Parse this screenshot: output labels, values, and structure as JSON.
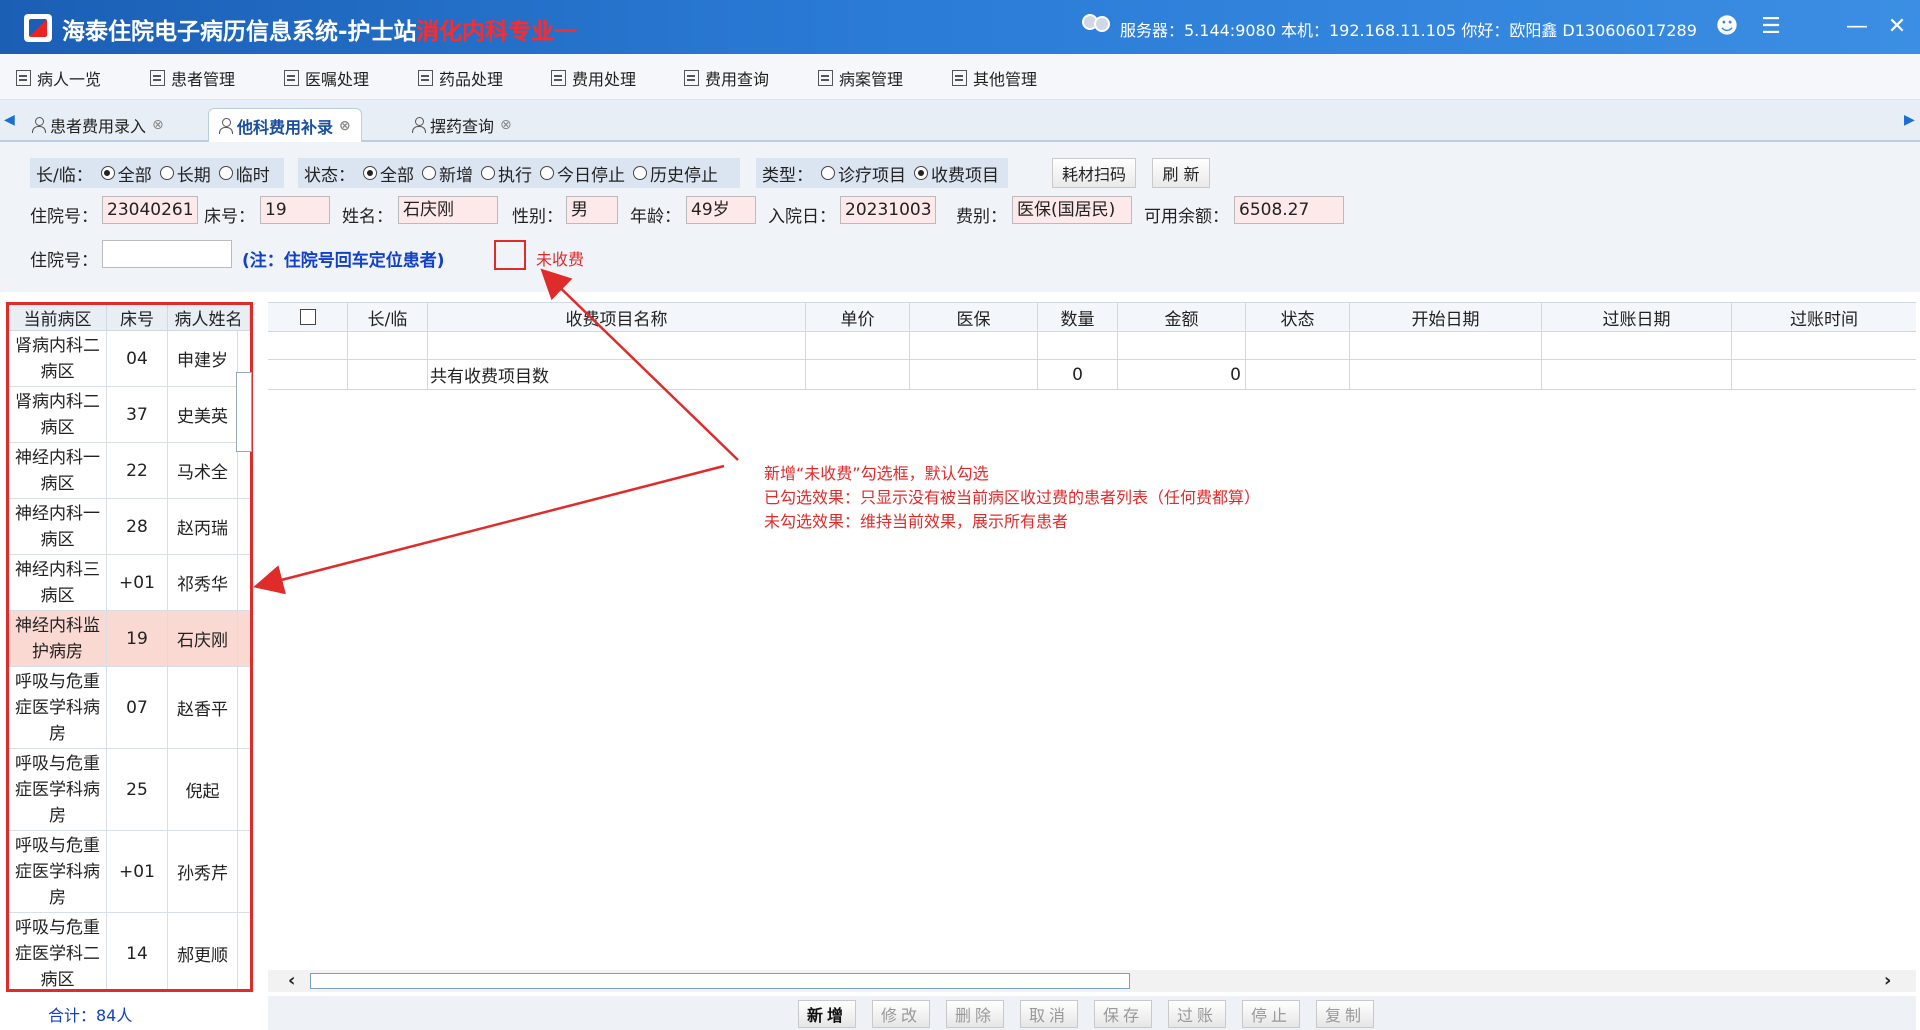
{
  "titlebar": {
    "app_title": "海泰住院电子病历信息系统-护士站",
    "app_sub": "消化内科专业一",
    "server_info": "服务器：5.144:9080 本机：192.168.11.105 你好：欧阳鑫 D130606017289",
    "icons": [
      "user-icon",
      "layers-icon",
      "minimize-icon",
      "close-icon"
    ]
  },
  "menu": [
    "病人一览",
    "患者管理",
    "医嘱处理",
    "药品处理",
    "费用处理",
    "费用查询",
    "病案管理",
    "其他管理"
  ],
  "tabs": [
    {
      "label": "患者费用录入",
      "active": false
    },
    {
      "label": "他科费用补录",
      "active": true
    },
    {
      "label": "摆药查询",
      "active": false
    }
  ],
  "filters": {
    "longtemp_label": "长/临：",
    "longtemp_options": [
      "全部",
      "长期",
      "临时"
    ],
    "longtemp_selected": "全部",
    "status_label": "状态：",
    "status_options": [
      "全部",
      "新增",
      "执行",
      "今日停止",
      "历史停止"
    ],
    "status_selected": "全部",
    "type_label": "类型：",
    "type_options": [
      "诊疗项目",
      "收费项目"
    ],
    "type_selected": "收费项目",
    "scan_button": "耗材扫码",
    "refresh_button": "刷 新"
  },
  "patient": {
    "admission_no_label": "住院号：",
    "admission_no": "23040261",
    "bed_label": "床号：",
    "bed": "19",
    "name_label": "姓名：",
    "name": "石庆刚",
    "sex_label": "性别：",
    "sex": "男",
    "age_label": "年龄：",
    "age": "49岁",
    "admit_date_label": "入院日：",
    "admit_date": "20231003",
    "fee_type_label": "费别：",
    "fee_type": "医保(国居民)",
    "balance_label": "可用余额：",
    "balance": "6508.27"
  },
  "search": {
    "admission_label": "住院号：",
    "admission_value": "",
    "note": "(注：住院号回车定位患者)",
    "unpaid_label": "未收费"
  },
  "patient_list": {
    "headers": [
      "当前病区",
      "床号",
      "病人姓名"
    ],
    "rows": [
      {
        "ward": "肾病内科二病区",
        "bed": "04",
        "name": "申建岁"
      },
      {
        "ward": "肾病内科二病区",
        "bed": "37",
        "name": "史美英"
      },
      {
        "ward": "神经内科一病区",
        "bed": "22",
        "name": "马术全"
      },
      {
        "ward": "神经内科一病区",
        "bed": "28",
        "name": "赵丙瑞"
      },
      {
        "ward": "神经内科三病区",
        "bed": "+01",
        "name": "祁秀华"
      },
      {
        "ward": "神经内科监护病房",
        "bed": "19",
        "name": "石庆刚",
        "selected": true
      },
      {
        "ward": "呼吸与危重症医学科病房",
        "bed": "07",
        "name": "赵香平"
      },
      {
        "ward": "呼吸与危重症医学科病房",
        "bed": "25",
        "name": "倪起"
      },
      {
        "ward": "呼吸与危重症医学科病房",
        "bed": "+01",
        "name": "孙秀芹"
      },
      {
        "ward": "呼吸与危重症医学科二病区",
        "bed": "14",
        "name": "郝更顺"
      }
    ],
    "total": "合计：84人"
  },
  "fee_table": {
    "headers": [
      "",
      "长/临",
      "收费项目名称",
      "单价",
      "医保",
      "数量",
      "金额",
      "状态",
      "开始日期",
      "过账日期",
      "过账时间"
    ],
    "summary_label": "共有收费项目数",
    "summary_qty": "0",
    "summary_amount": "0"
  },
  "bottom_buttons": [
    {
      "label": "新增",
      "enabled": true
    },
    {
      "label": "修改",
      "enabled": false
    },
    {
      "label": "删除",
      "enabled": false
    },
    {
      "label": "取消",
      "enabled": false
    },
    {
      "label": "保存",
      "enabled": false
    },
    {
      "label": "过账",
      "enabled": false
    },
    {
      "label": "停止",
      "enabled": false
    },
    {
      "label": "复制",
      "enabled": false
    }
  ],
  "annotation": {
    "line1": "新增“未收费”勾选框，默认勾选",
    "line2": "已勾选效果：只显示没有被当前病区收过费的患者列表（任何费都算）",
    "line3": "未勾选效果：维持当前效果，展示所有患者"
  },
  "colors": {
    "accent": "#1b5fb5",
    "annotation": "#e02b2b",
    "selected_row": "#f9d9d2"
  }
}
